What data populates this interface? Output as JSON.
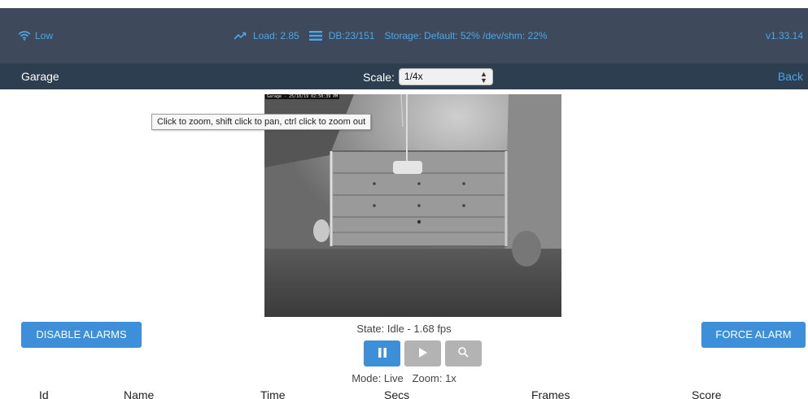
{
  "topbar": {
    "bandwidth": "Low",
    "load": "Load: 2.85",
    "db": "DB:23/151",
    "storage": "Storage: Default: 52% /dev/shm: 22%",
    "version": "v1.33.14"
  },
  "subbar": {
    "monitor_name": "Garage",
    "scale_label": "Scale:",
    "scale_value": "1/4x",
    "back_label": "Back"
  },
  "feed": {
    "osd_text": "Garage - 25/10/19 02:50:39 PM"
  },
  "tooltip": "Click to zoom, shift click to pan, ctrl click to zoom out",
  "buttons": {
    "disable_alarms": "DISABLE ALARMS",
    "force_alarm": "FORCE ALARM"
  },
  "state": "State: Idle - 1.68 fps",
  "mode": "Mode: Live   Zoom: 1x",
  "table": {
    "columns": [
      "Id",
      "Name",
      "Time",
      "Secs",
      "Frames",
      "Score"
    ]
  },
  "colors": {
    "topbar_bg": "#3e4a5b",
    "subbar_bg": "#2c3e50",
    "accent": "#4aa6e8",
    "button_blue": "#3d8fd9",
    "button_disabled": "#b3b3b3"
  },
  "icons": {
    "bandwidth": "wifi-icon",
    "load": "trend-up-icon",
    "db": "list-icon",
    "pause": "pause-icon",
    "play": "play-icon",
    "zoom": "search-icon"
  }
}
